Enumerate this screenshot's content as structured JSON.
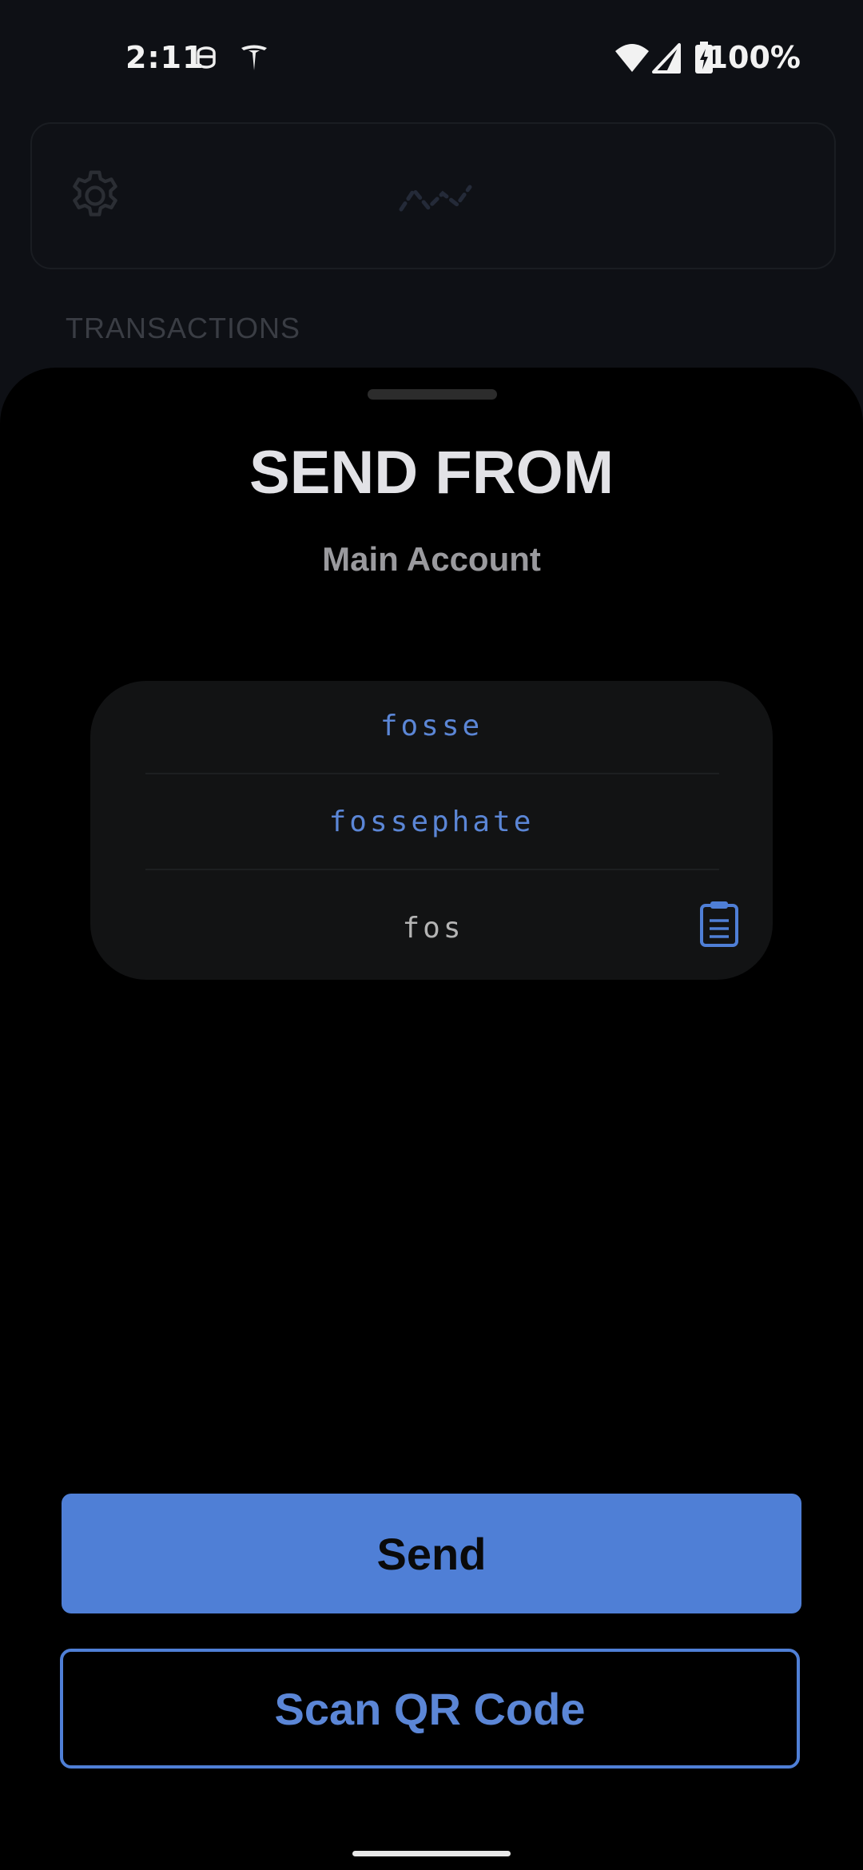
{
  "status_bar": {
    "time": "2:11",
    "battery": "100%",
    "icons": [
      "notification-face-icon",
      "tesla-icon",
      "wifi-icon",
      "signal-icon",
      "battery-charging-icon"
    ]
  },
  "background": {
    "settings_icon": "gear-icon",
    "logo_icon": "nano-logo-icon",
    "section_label": "TRANSACTIONS"
  },
  "sheet": {
    "title": "SEND FROM",
    "account": "Main Account",
    "suggestions": [
      "fosse",
      "fossephate"
    ],
    "address_input": {
      "value": "fos",
      "placeholder": ""
    },
    "paste_icon": "clipboard-icon"
  },
  "actions": {
    "send_label": "Send",
    "scan_label": "Scan QR Code"
  },
  "colors": {
    "accent": "#4f7fd6",
    "background": "#000000",
    "card": "#121314",
    "title": "#e2e2e6"
  }
}
